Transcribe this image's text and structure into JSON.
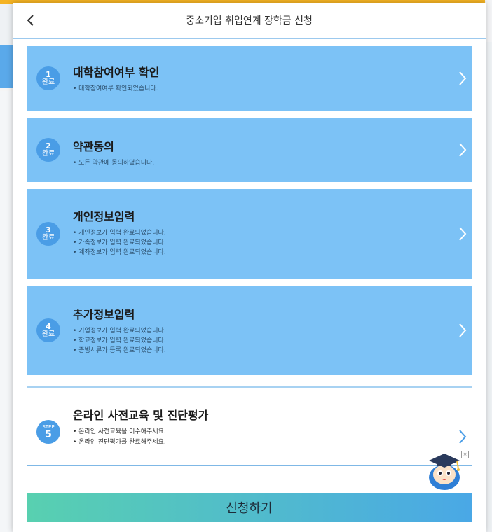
{
  "header": {
    "title": "중소기업 취업연계 장학금 신청"
  },
  "steps": [
    {
      "num": "1",
      "done": "완료",
      "title": "대학참여여부 확인",
      "items": [
        "대학참여여부 확인되었습니다."
      ]
    },
    {
      "num": "2",
      "done": "완료",
      "title": "약관동의",
      "items": [
        "모든 약관에 동의하였습니다."
      ]
    },
    {
      "num": "3",
      "done": "완료",
      "title": "개인정보입력",
      "items": [
        "개인정보가 입력 완료되었습니다.",
        "가족정보가 입력 완료되었습니다.",
        "계좌정보가 입력 완료되었습니다."
      ]
    },
    {
      "num": "4",
      "done": "완료",
      "title": "추가정보입력",
      "items": [
        "기업정보가 입력 완료되었습니다.",
        "학교정보가 입력 완료되었습니다.",
        "증빙서류가 등록 완료되었습니다."
      ]
    }
  ],
  "step5": {
    "label": "STEP",
    "num": "5",
    "title": "온라인 사전교육 및 진단평가",
    "items": [
      "온라인 사전교육을 이수해주세요.",
      "온라인 진단평가를 완료해주세요."
    ]
  },
  "mascot": {
    "close": "×"
  },
  "apply": {
    "label": "신청하기"
  },
  "colors": {
    "step_done": "#7cc2f6",
    "badge": "#4a9de6",
    "apply_start": "#58d0b0",
    "apply_end": "#4aa8e6"
  },
  "icons": {
    "back": "chevron-left-icon",
    "next": "chevron-right-icon",
    "mascot": "mascot-icon"
  }
}
